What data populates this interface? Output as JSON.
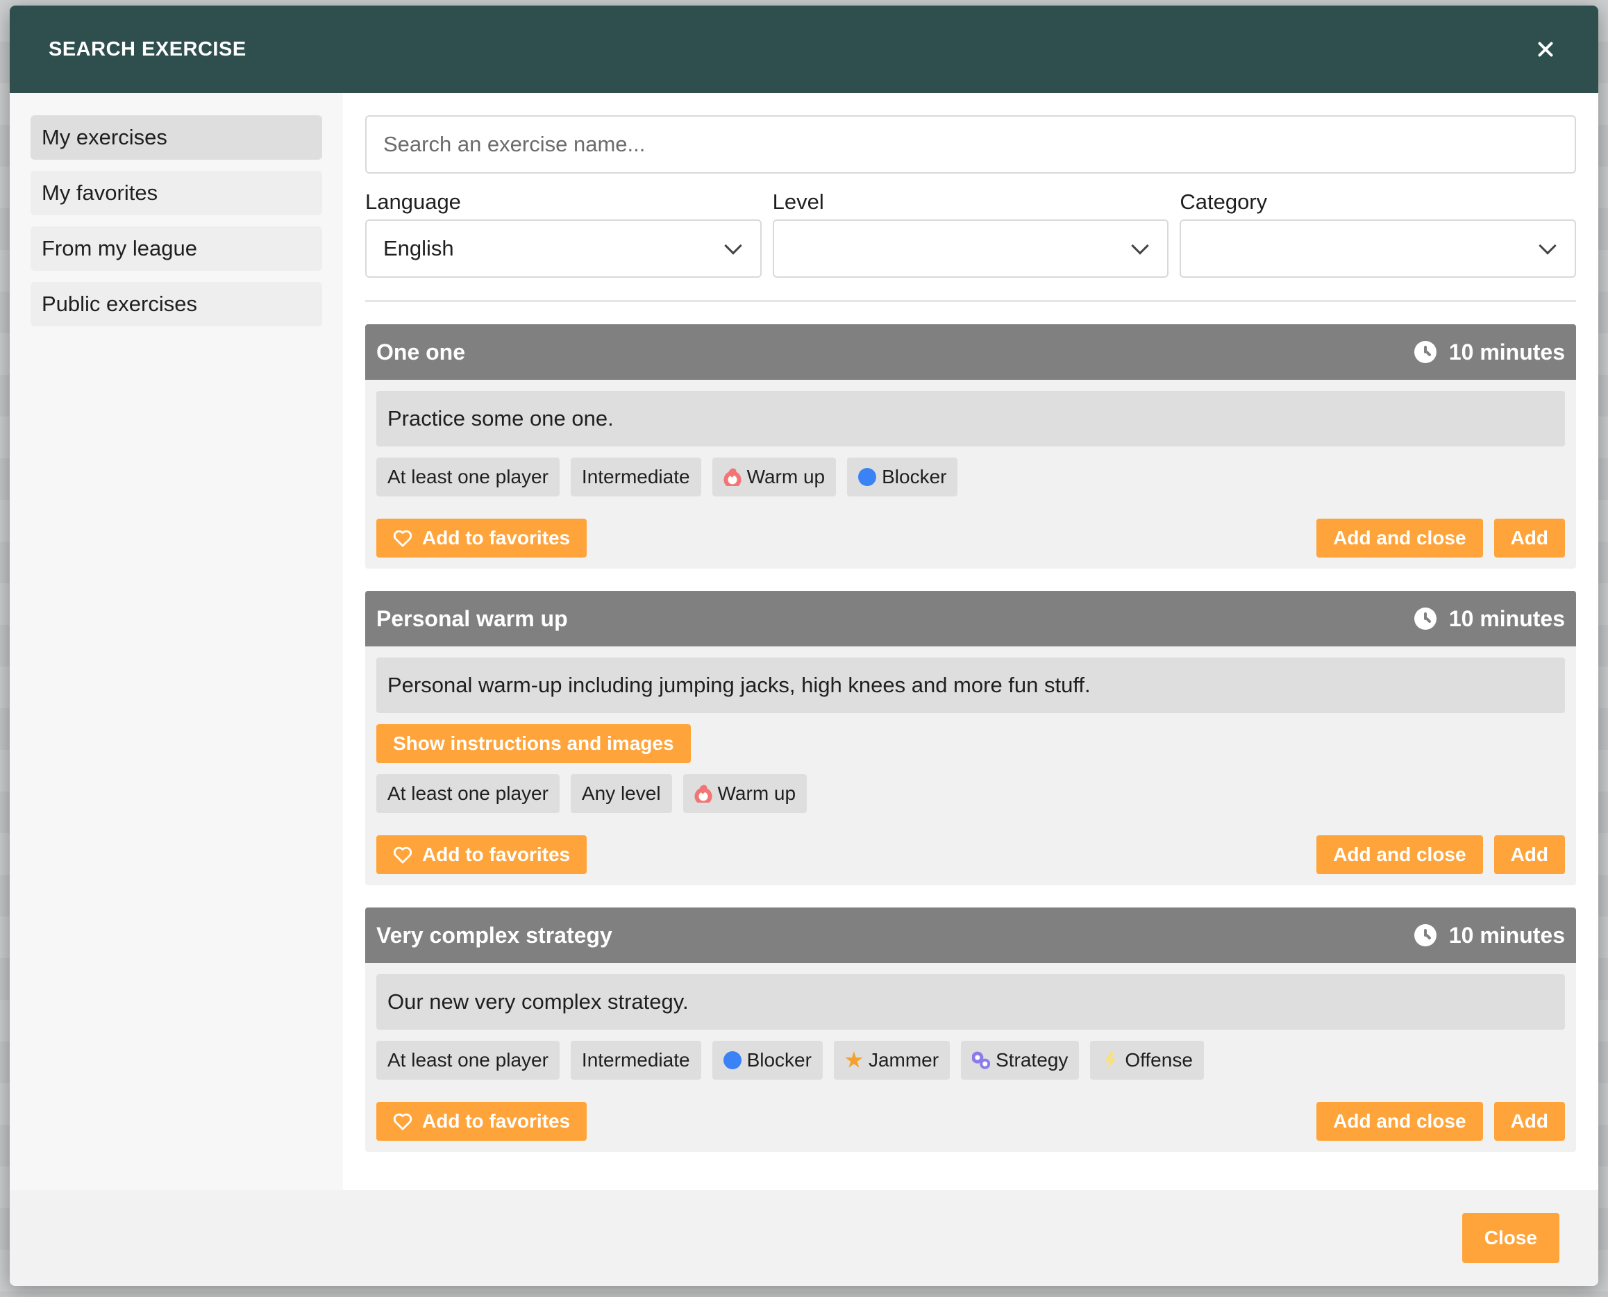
{
  "modal": {
    "title": "SEARCH EXERCISE",
    "close_button_label": "Close"
  },
  "sidebar": {
    "items": [
      {
        "label": "My exercises",
        "active": true
      },
      {
        "label": "My favorites",
        "active": false
      },
      {
        "label": "From my league",
        "active": false
      },
      {
        "label": "Public exercises",
        "active": false
      }
    ]
  },
  "search": {
    "placeholder": "Search an exercise name...",
    "value": ""
  },
  "filters": {
    "language": {
      "label": "Language",
      "value": "English"
    },
    "level": {
      "label": "Level",
      "value": ""
    },
    "category": {
      "label": "Category",
      "value": ""
    }
  },
  "exercises": [
    {
      "title": "One one",
      "duration": "10 minutes",
      "description": "Practice some one one.",
      "tags": [
        "At least one player",
        "Intermediate",
        "Warm up",
        "Blocker"
      ],
      "favorite_label": "Add to favorites",
      "add_close_label": "Add and close",
      "add_label": "Add"
    },
    {
      "title": "Personal warm up",
      "duration": "10 minutes",
      "description": "Personal warm-up including jumping jacks, high knees and more fun stuff.",
      "show_instructions_label": "Show instructions and images",
      "tags": [
        "At least one player",
        "Any level",
        "Warm up"
      ],
      "favorite_label": "Add to favorites",
      "add_close_label": "Add and close",
      "add_label": "Add"
    },
    {
      "title": "Very complex strategy",
      "duration": "10 minutes",
      "description": "Our new very complex strategy.",
      "tags": [
        "At least one player",
        "Intermediate",
        "Blocker",
        "Jammer",
        "Strategy",
        "Offense"
      ],
      "favorite_label": "Add to favorites",
      "add_close_label": "Add and close",
      "add_label": "Add"
    }
  ],
  "colors": {
    "header_bg": "#2f4f4f",
    "accent": "#ffa43a",
    "card_header_bg": "#808080"
  },
  "icons": {
    "warm_up": "fire-icon",
    "blocker": "blue-circle-icon",
    "jammer": "star-icon",
    "strategy": "gears-icon",
    "offense": "lightning-icon",
    "duration": "clock-icon",
    "favorite": "heart-icon"
  }
}
